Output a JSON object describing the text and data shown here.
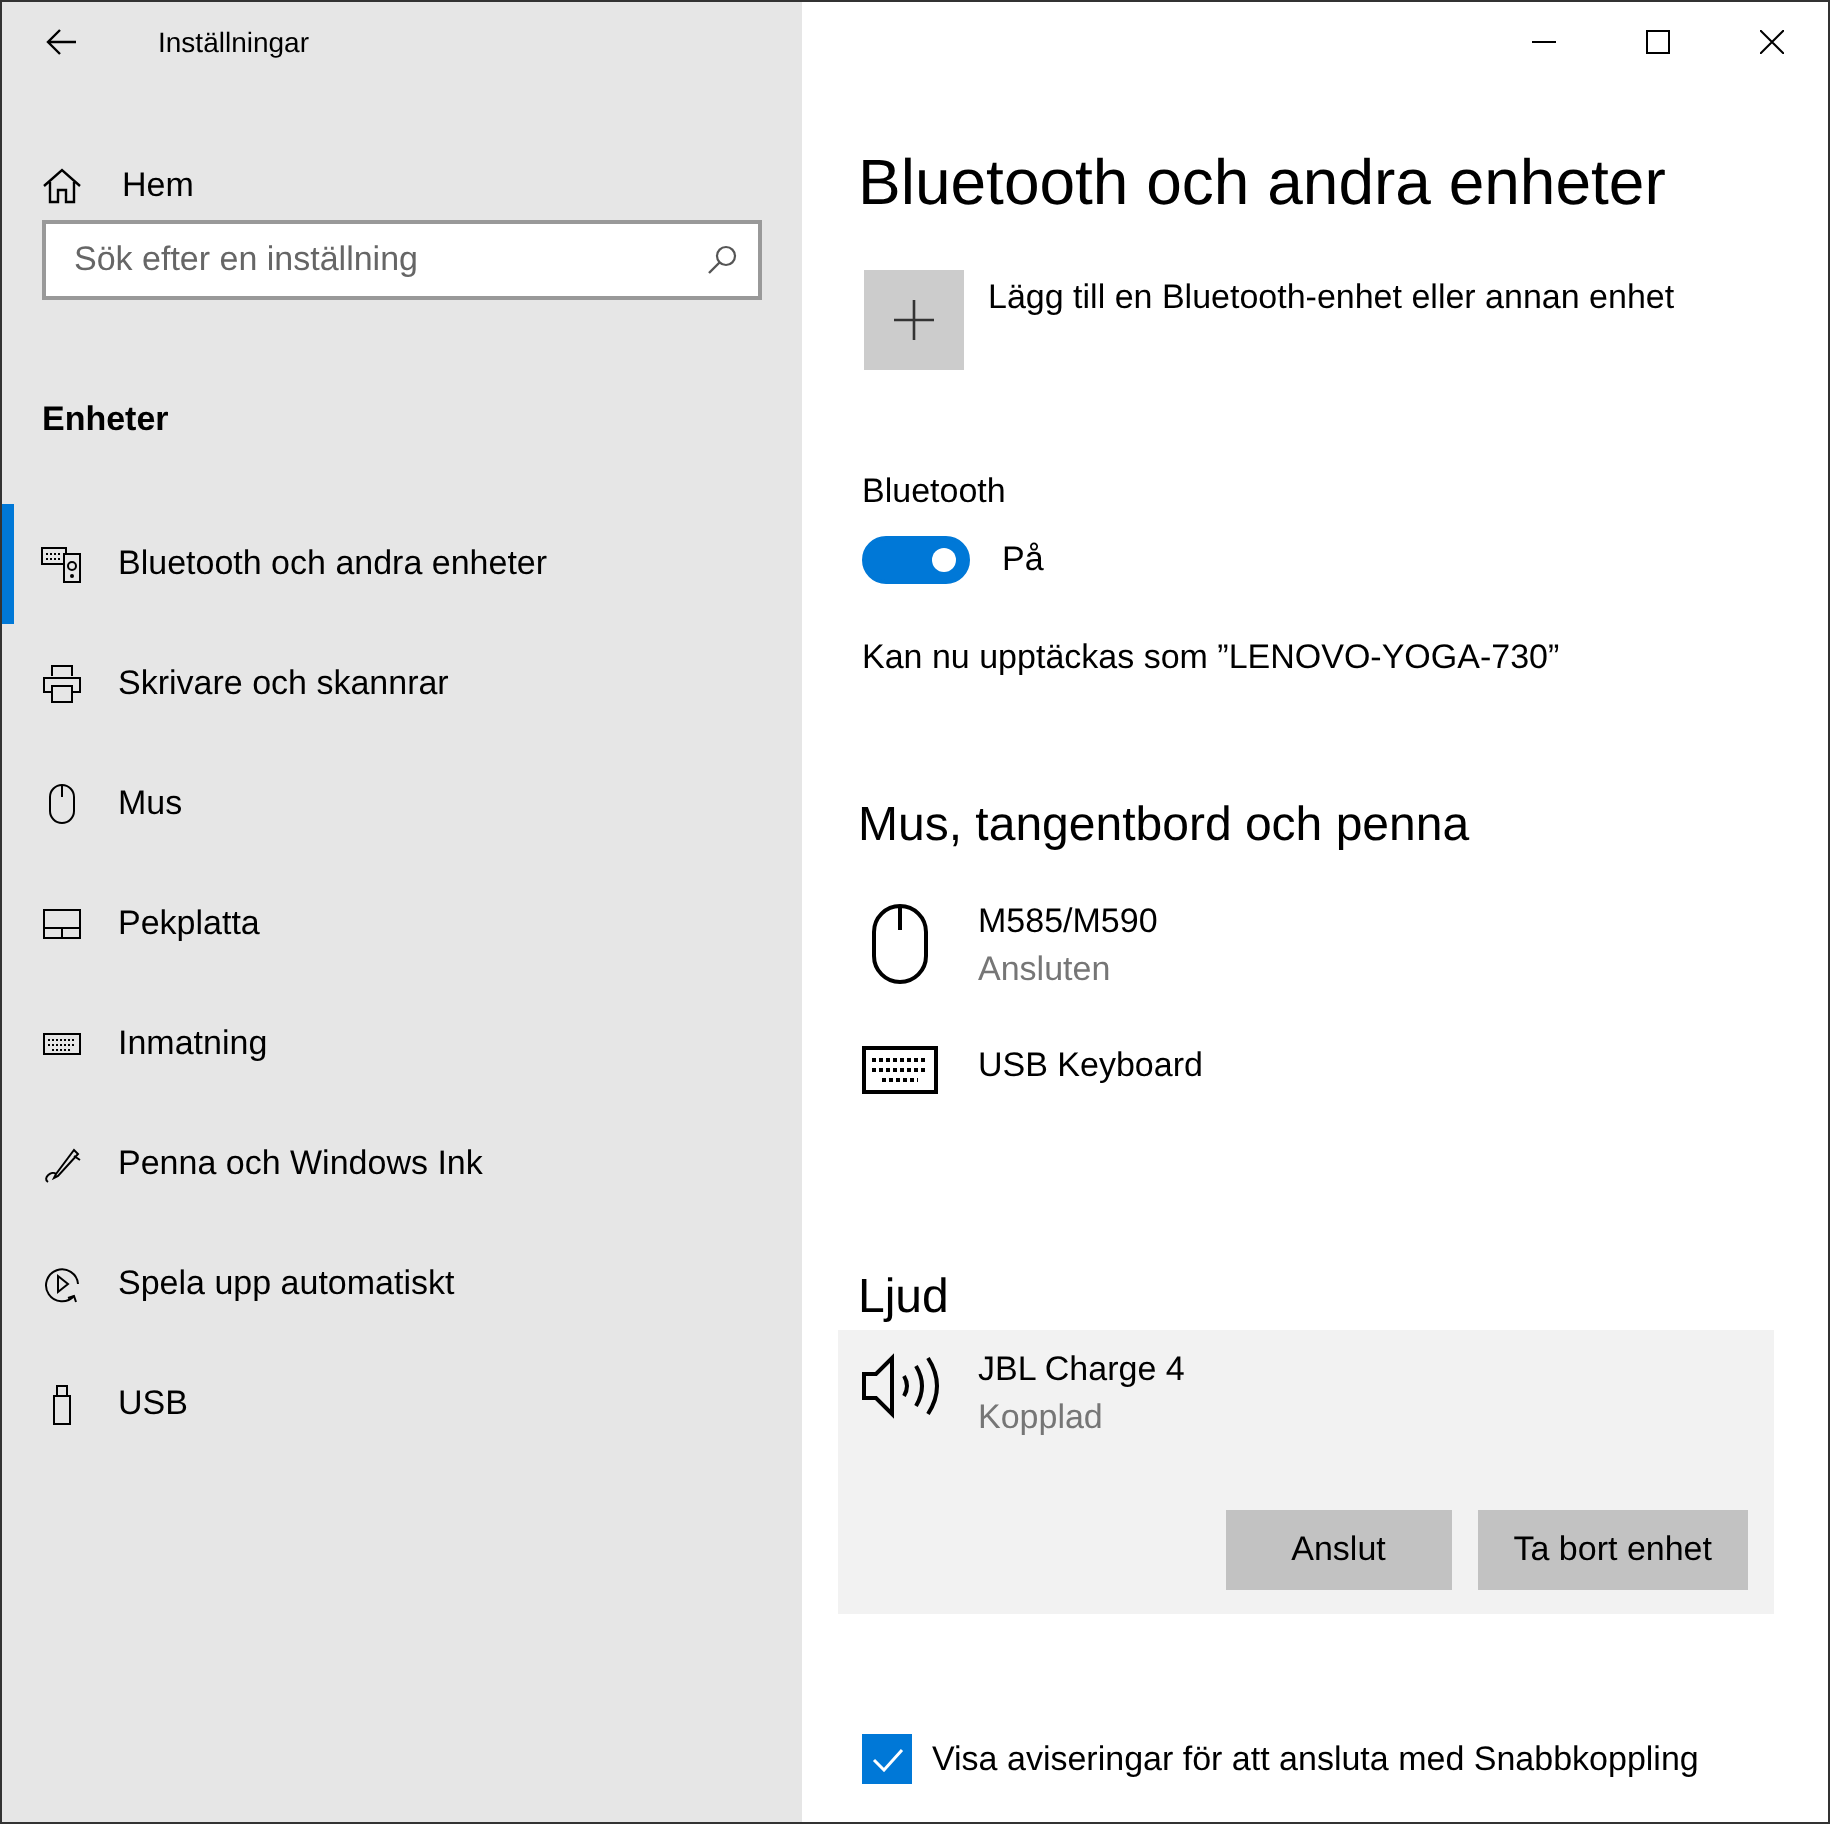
{
  "window": {
    "title": "Inställningar"
  },
  "sidebar": {
    "home": "Hem",
    "search": {
      "placeholder": "Sök efter en inställning"
    },
    "section": "Enheter",
    "items": [
      {
        "label": "Bluetooth och andra enheter",
        "selected": true
      },
      {
        "label": "Skrivare och skannrar",
        "selected": false
      },
      {
        "label": "Mus",
        "selected": false
      },
      {
        "label": "Pekplatta",
        "selected": false
      },
      {
        "label": "Inmatning",
        "selected": false
      },
      {
        "label": "Penna och Windows Ink",
        "selected": false
      },
      {
        "label": "Spela upp automatiskt",
        "selected": false
      },
      {
        "label": "USB",
        "selected": false
      }
    ]
  },
  "page": {
    "title": "Bluetooth och andra enheter",
    "add_device": "Lägg till en Bluetooth-enhet eller annan enhet",
    "bluetooth": {
      "label": "Bluetooth",
      "on": true,
      "state_text": "På"
    },
    "discoverable": "Kan nu upptäckas som ”LENOVO-YOGA-730”",
    "sections": [
      {
        "title": "Mus, tangentbord och penna",
        "devices": [
          {
            "kind": "mouse",
            "name": "M585/M590",
            "status": "Ansluten",
            "selected": false
          },
          {
            "kind": "keyboard",
            "name": "USB Keyboard",
            "selected": false
          }
        ]
      },
      {
        "title": "Ljud",
        "devices": [
          {
            "kind": "speaker",
            "name": "JBL Charge 4",
            "status": "Kopplad",
            "selected": true,
            "buttons": [
              "Anslut",
              "Ta bort enhet"
            ]
          }
        ]
      }
    ],
    "swift_pair": {
      "label": "Visa aviseringar för att ansluta med Snabbkoppling",
      "checked": true
    }
  }
}
